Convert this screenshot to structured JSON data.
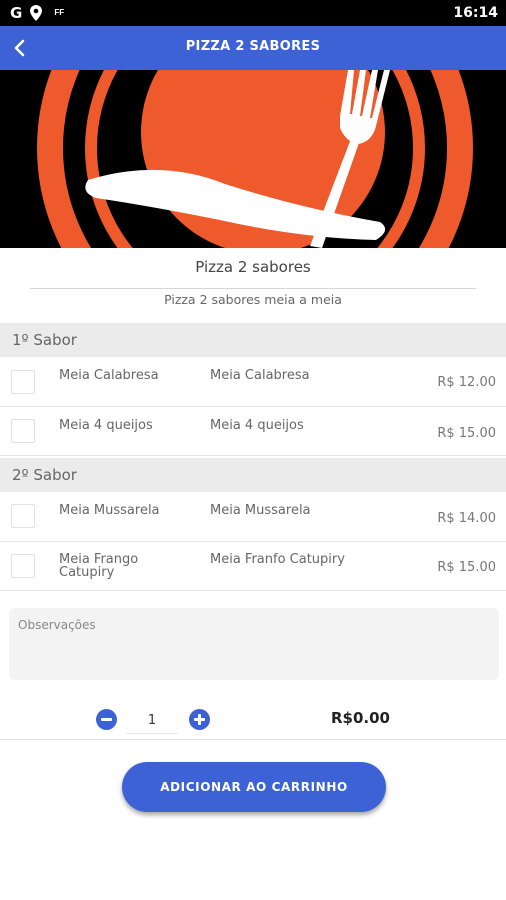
{
  "status_bar": {
    "left_icons": [
      "google-icon",
      "location-icon",
      "notification-icon"
    ],
    "google_glyph": "G",
    "small_glyph": "FF",
    "time": "16:14"
  },
  "app_bar": {
    "title": "PIZZA 2 SABORES",
    "back_icon": "chevron-left-icon",
    "background": "#3d62d6"
  },
  "hero": {
    "description": "fork-and-knife-plate-logo",
    "colors": {
      "background": "#000000",
      "plate": "#ee5a2b",
      "utensils": "#ffffff"
    }
  },
  "product": {
    "name": "Pizza 2 sabores",
    "description": "Pizza 2 sabores meia a meia"
  },
  "sections": [
    {
      "title": "1º Sabor",
      "options": [
        {
          "name": "Meia Calabresa",
          "description": "Meia Calabresa",
          "price": "R$ 12.00",
          "checked": false
        },
        {
          "name": "Meia 4 queijos",
          "description": "Meia 4 queijos",
          "price": "R$ 15.00",
          "checked": false
        }
      ]
    },
    {
      "title": "2º Sabor",
      "options": [
        {
          "name": "Meia Mussarela",
          "description": "Meia Mussarela",
          "price": "R$ 14.00",
          "checked": false
        },
        {
          "name": "Meia Frango Catupiry",
          "description": "Meia Franfo Catupiry",
          "price": "R$ 15.00",
          "checked": false
        }
      ]
    }
  ],
  "notes": {
    "placeholder": "Observações",
    "value": ""
  },
  "quantity": {
    "value": "1",
    "minus_icon": "minus-circle-icon",
    "plus_icon": "plus-circle-icon"
  },
  "total": "R$0.00",
  "add_button": {
    "label": "ADICIONAR AO CARRINHO"
  },
  "accent_color": "#3d62d6"
}
